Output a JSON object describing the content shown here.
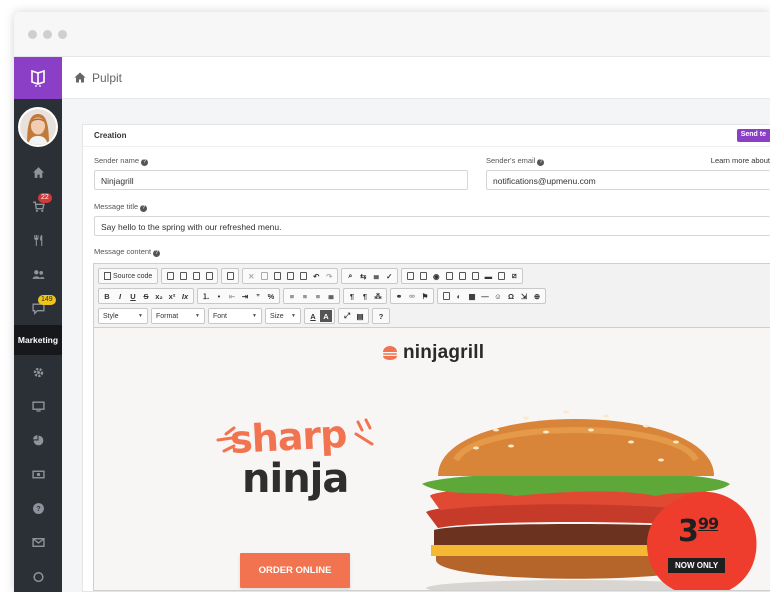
{
  "window": {
    "controls": [
      "close",
      "minimize",
      "maximize"
    ]
  },
  "sidebar": {
    "logo_icon": "book-icon",
    "items": [
      {
        "name": "home",
        "icon": "home-icon"
      },
      {
        "name": "orders",
        "icon": "cart-icon",
        "badge": "22"
      },
      {
        "name": "menu",
        "icon": "fork-knife-icon"
      },
      {
        "name": "customers",
        "icon": "users-icon"
      },
      {
        "name": "messages",
        "icon": "comment-icon",
        "badge": "149"
      }
    ],
    "section_label": "Marketing",
    "items_after": [
      {
        "name": "settings",
        "icon": "gear-icon"
      },
      {
        "name": "website",
        "icon": "monitor-icon"
      },
      {
        "name": "reports",
        "icon": "pie-chart-icon"
      },
      {
        "name": "payments",
        "icon": "money-icon"
      },
      {
        "name": "help",
        "icon": "question-icon"
      },
      {
        "name": "mail",
        "icon": "envelope-icon"
      },
      {
        "name": "power",
        "icon": "power-icon"
      }
    ]
  },
  "topbar": {
    "breadcrumb": "Pulpit"
  },
  "panel": {
    "title": "Creation",
    "send_button": "Send te",
    "sender_name_label": "Sender name",
    "sender_name_value": "Ninjagrill",
    "sender_email_label": "Sender's email",
    "sender_email_value": "notifications@upmenu.com",
    "learn_more": "Learn more about",
    "message_title_label": "Message title",
    "message_title_value": "Say hello to the spring with our refreshed menu.",
    "message_content_label": "Message content"
  },
  "editor": {
    "source_code": "Source code",
    "format_buttons": [
      "B",
      "I",
      "U",
      "S",
      "x₂",
      "x²",
      "Ix"
    ],
    "combos": {
      "style": "Style",
      "format": "Format",
      "font": "Font",
      "size": "Size"
    },
    "help": "?"
  },
  "email": {
    "brand": "ninjagrill",
    "headline_1": "sharp",
    "headline_2": "ninja",
    "cta": "ORDER ONLINE",
    "price_main": "3",
    "price_cents": "99",
    "price_note": "NOW ONLY",
    "accent_color": "#f2734f"
  }
}
